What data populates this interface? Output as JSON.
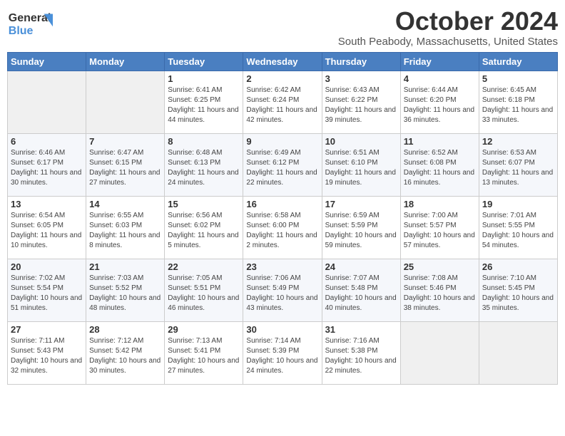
{
  "header": {
    "logo_line1": "General",
    "logo_line2": "Blue",
    "month": "October 2024",
    "location": "South Peabody, Massachusetts, United States"
  },
  "weekdays": [
    "Sunday",
    "Monday",
    "Tuesday",
    "Wednesday",
    "Thursday",
    "Friday",
    "Saturday"
  ],
  "weeks": [
    [
      {
        "day": "",
        "sunrise": "",
        "sunset": "",
        "daylight": ""
      },
      {
        "day": "",
        "sunrise": "",
        "sunset": "",
        "daylight": ""
      },
      {
        "day": "1",
        "sunrise": "Sunrise: 6:41 AM",
        "sunset": "Sunset: 6:25 PM",
        "daylight": "Daylight: 11 hours and 44 minutes."
      },
      {
        "day": "2",
        "sunrise": "Sunrise: 6:42 AM",
        "sunset": "Sunset: 6:24 PM",
        "daylight": "Daylight: 11 hours and 42 minutes."
      },
      {
        "day": "3",
        "sunrise": "Sunrise: 6:43 AM",
        "sunset": "Sunset: 6:22 PM",
        "daylight": "Daylight: 11 hours and 39 minutes."
      },
      {
        "day": "4",
        "sunrise": "Sunrise: 6:44 AM",
        "sunset": "Sunset: 6:20 PM",
        "daylight": "Daylight: 11 hours and 36 minutes."
      },
      {
        "day": "5",
        "sunrise": "Sunrise: 6:45 AM",
        "sunset": "Sunset: 6:18 PM",
        "daylight": "Daylight: 11 hours and 33 minutes."
      }
    ],
    [
      {
        "day": "6",
        "sunrise": "Sunrise: 6:46 AM",
        "sunset": "Sunset: 6:17 PM",
        "daylight": "Daylight: 11 hours and 30 minutes."
      },
      {
        "day": "7",
        "sunrise": "Sunrise: 6:47 AM",
        "sunset": "Sunset: 6:15 PM",
        "daylight": "Daylight: 11 hours and 27 minutes."
      },
      {
        "day": "8",
        "sunrise": "Sunrise: 6:48 AM",
        "sunset": "Sunset: 6:13 PM",
        "daylight": "Daylight: 11 hours and 24 minutes."
      },
      {
        "day": "9",
        "sunrise": "Sunrise: 6:49 AM",
        "sunset": "Sunset: 6:12 PM",
        "daylight": "Daylight: 11 hours and 22 minutes."
      },
      {
        "day": "10",
        "sunrise": "Sunrise: 6:51 AM",
        "sunset": "Sunset: 6:10 PM",
        "daylight": "Daylight: 11 hours and 19 minutes."
      },
      {
        "day": "11",
        "sunrise": "Sunrise: 6:52 AM",
        "sunset": "Sunset: 6:08 PM",
        "daylight": "Daylight: 11 hours and 16 minutes."
      },
      {
        "day": "12",
        "sunrise": "Sunrise: 6:53 AM",
        "sunset": "Sunset: 6:07 PM",
        "daylight": "Daylight: 11 hours and 13 minutes."
      }
    ],
    [
      {
        "day": "13",
        "sunrise": "Sunrise: 6:54 AM",
        "sunset": "Sunset: 6:05 PM",
        "daylight": "Daylight: 11 hours and 10 minutes."
      },
      {
        "day": "14",
        "sunrise": "Sunrise: 6:55 AM",
        "sunset": "Sunset: 6:03 PM",
        "daylight": "Daylight: 11 hours and 8 minutes."
      },
      {
        "day": "15",
        "sunrise": "Sunrise: 6:56 AM",
        "sunset": "Sunset: 6:02 PM",
        "daylight": "Daylight: 11 hours and 5 minutes."
      },
      {
        "day": "16",
        "sunrise": "Sunrise: 6:58 AM",
        "sunset": "Sunset: 6:00 PM",
        "daylight": "Daylight: 11 hours and 2 minutes."
      },
      {
        "day": "17",
        "sunrise": "Sunrise: 6:59 AM",
        "sunset": "Sunset: 5:59 PM",
        "daylight": "Daylight: 10 hours and 59 minutes."
      },
      {
        "day": "18",
        "sunrise": "Sunrise: 7:00 AM",
        "sunset": "Sunset: 5:57 PM",
        "daylight": "Daylight: 10 hours and 57 minutes."
      },
      {
        "day": "19",
        "sunrise": "Sunrise: 7:01 AM",
        "sunset": "Sunset: 5:55 PM",
        "daylight": "Daylight: 10 hours and 54 minutes."
      }
    ],
    [
      {
        "day": "20",
        "sunrise": "Sunrise: 7:02 AM",
        "sunset": "Sunset: 5:54 PM",
        "daylight": "Daylight: 10 hours and 51 minutes."
      },
      {
        "day": "21",
        "sunrise": "Sunrise: 7:03 AM",
        "sunset": "Sunset: 5:52 PM",
        "daylight": "Daylight: 10 hours and 48 minutes."
      },
      {
        "day": "22",
        "sunrise": "Sunrise: 7:05 AM",
        "sunset": "Sunset: 5:51 PM",
        "daylight": "Daylight: 10 hours and 46 minutes."
      },
      {
        "day": "23",
        "sunrise": "Sunrise: 7:06 AM",
        "sunset": "Sunset: 5:49 PM",
        "daylight": "Daylight: 10 hours and 43 minutes."
      },
      {
        "day": "24",
        "sunrise": "Sunrise: 7:07 AM",
        "sunset": "Sunset: 5:48 PM",
        "daylight": "Daylight: 10 hours and 40 minutes."
      },
      {
        "day": "25",
        "sunrise": "Sunrise: 7:08 AM",
        "sunset": "Sunset: 5:46 PM",
        "daylight": "Daylight: 10 hours and 38 minutes."
      },
      {
        "day": "26",
        "sunrise": "Sunrise: 7:10 AM",
        "sunset": "Sunset: 5:45 PM",
        "daylight": "Daylight: 10 hours and 35 minutes."
      }
    ],
    [
      {
        "day": "27",
        "sunrise": "Sunrise: 7:11 AM",
        "sunset": "Sunset: 5:43 PM",
        "daylight": "Daylight: 10 hours and 32 minutes."
      },
      {
        "day": "28",
        "sunrise": "Sunrise: 7:12 AM",
        "sunset": "Sunset: 5:42 PM",
        "daylight": "Daylight: 10 hours and 30 minutes."
      },
      {
        "day": "29",
        "sunrise": "Sunrise: 7:13 AM",
        "sunset": "Sunset: 5:41 PM",
        "daylight": "Daylight: 10 hours and 27 minutes."
      },
      {
        "day": "30",
        "sunrise": "Sunrise: 7:14 AM",
        "sunset": "Sunset: 5:39 PM",
        "daylight": "Daylight: 10 hours and 24 minutes."
      },
      {
        "day": "31",
        "sunrise": "Sunrise: 7:16 AM",
        "sunset": "Sunset: 5:38 PM",
        "daylight": "Daylight: 10 hours and 22 minutes."
      },
      {
        "day": "",
        "sunrise": "",
        "sunset": "",
        "daylight": ""
      },
      {
        "day": "",
        "sunrise": "",
        "sunset": "",
        "daylight": ""
      }
    ]
  ]
}
